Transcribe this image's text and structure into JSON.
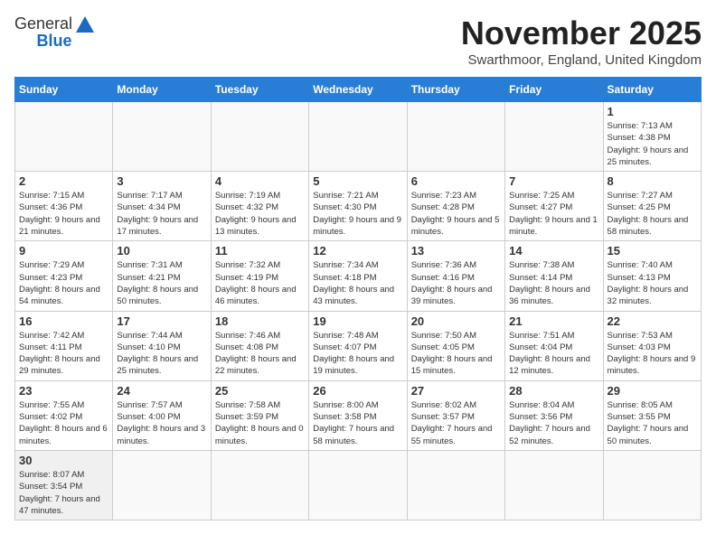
{
  "header": {
    "logo_general": "General",
    "logo_blue": "Blue",
    "month_title": "November 2025",
    "location": "Swarthmoor, England, United Kingdom"
  },
  "days_of_week": [
    "Sunday",
    "Monday",
    "Tuesday",
    "Wednesday",
    "Thursday",
    "Friday",
    "Saturday"
  ],
  "weeks": [
    [
      {
        "day": "",
        "info": ""
      },
      {
        "day": "",
        "info": ""
      },
      {
        "day": "",
        "info": ""
      },
      {
        "day": "",
        "info": ""
      },
      {
        "day": "",
        "info": ""
      },
      {
        "day": "",
        "info": ""
      },
      {
        "day": "1",
        "info": "Sunrise: 7:13 AM\nSunset: 4:38 PM\nDaylight: 9 hours and 25 minutes."
      }
    ],
    [
      {
        "day": "2",
        "info": "Sunrise: 7:15 AM\nSunset: 4:36 PM\nDaylight: 9 hours and 21 minutes."
      },
      {
        "day": "3",
        "info": "Sunrise: 7:17 AM\nSunset: 4:34 PM\nDaylight: 9 hours and 17 minutes."
      },
      {
        "day": "4",
        "info": "Sunrise: 7:19 AM\nSunset: 4:32 PM\nDaylight: 9 hours and 13 minutes."
      },
      {
        "day": "5",
        "info": "Sunrise: 7:21 AM\nSunset: 4:30 PM\nDaylight: 9 hours and 9 minutes."
      },
      {
        "day": "6",
        "info": "Sunrise: 7:23 AM\nSunset: 4:28 PM\nDaylight: 9 hours and 5 minutes."
      },
      {
        "day": "7",
        "info": "Sunrise: 7:25 AM\nSunset: 4:27 PM\nDaylight: 9 hours and 1 minute."
      },
      {
        "day": "8",
        "info": "Sunrise: 7:27 AM\nSunset: 4:25 PM\nDaylight: 8 hours and 58 minutes."
      }
    ],
    [
      {
        "day": "9",
        "info": "Sunrise: 7:29 AM\nSunset: 4:23 PM\nDaylight: 8 hours and 54 minutes."
      },
      {
        "day": "10",
        "info": "Sunrise: 7:31 AM\nSunset: 4:21 PM\nDaylight: 8 hours and 50 minutes."
      },
      {
        "day": "11",
        "info": "Sunrise: 7:32 AM\nSunset: 4:19 PM\nDaylight: 8 hours and 46 minutes."
      },
      {
        "day": "12",
        "info": "Sunrise: 7:34 AM\nSunset: 4:18 PM\nDaylight: 8 hours and 43 minutes."
      },
      {
        "day": "13",
        "info": "Sunrise: 7:36 AM\nSunset: 4:16 PM\nDaylight: 8 hours and 39 minutes."
      },
      {
        "day": "14",
        "info": "Sunrise: 7:38 AM\nSunset: 4:14 PM\nDaylight: 8 hours and 36 minutes."
      },
      {
        "day": "15",
        "info": "Sunrise: 7:40 AM\nSunset: 4:13 PM\nDaylight: 8 hours and 32 minutes."
      }
    ],
    [
      {
        "day": "16",
        "info": "Sunrise: 7:42 AM\nSunset: 4:11 PM\nDaylight: 8 hours and 29 minutes."
      },
      {
        "day": "17",
        "info": "Sunrise: 7:44 AM\nSunset: 4:10 PM\nDaylight: 8 hours and 25 minutes."
      },
      {
        "day": "18",
        "info": "Sunrise: 7:46 AM\nSunset: 4:08 PM\nDaylight: 8 hours and 22 minutes."
      },
      {
        "day": "19",
        "info": "Sunrise: 7:48 AM\nSunset: 4:07 PM\nDaylight: 8 hours and 19 minutes."
      },
      {
        "day": "20",
        "info": "Sunrise: 7:50 AM\nSunset: 4:05 PM\nDaylight: 8 hours and 15 minutes."
      },
      {
        "day": "21",
        "info": "Sunrise: 7:51 AM\nSunset: 4:04 PM\nDaylight: 8 hours and 12 minutes."
      },
      {
        "day": "22",
        "info": "Sunrise: 7:53 AM\nSunset: 4:03 PM\nDaylight: 8 hours and 9 minutes."
      }
    ],
    [
      {
        "day": "23",
        "info": "Sunrise: 7:55 AM\nSunset: 4:02 PM\nDaylight: 8 hours and 6 minutes."
      },
      {
        "day": "24",
        "info": "Sunrise: 7:57 AM\nSunset: 4:00 PM\nDaylight: 8 hours and 3 minutes."
      },
      {
        "day": "25",
        "info": "Sunrise: 7:58 AM\nSunset: 3:59 PM\nDaylight: 8 hours and 0 minutes."
      },
      {
        "day": "26",
        "info": "Sunrise: 8:00 AM\nSunset: 3:58 PM\nDaylight: 7 hours and 58 minutes."
      },
      {
        "day": "27",
        "info": "Sunrise: 8:02 AM\nSunset: 3:57 PM\nDaylight: 7 hours and 55 minutes."
      },
      {
        "day": "28",
        "info": "Sunrise: 8:04 AM\nSunset: 3:56 PM\nDaylight: 7 hours and 52 minutes."
      },
      {
        "day": "29",
        "info": "Sunrise: 8:05 AM\nSunset: 3:55 PM\nDaylight: 7 hours and 50 minutes."
      }
    ],
    [
      {
        "day": "30",
        "info": "Sunrise: 8:07 AM\nSunset: 3:54 PM\nDaylight: 7 hours and 47 minutes."
      },
      {
        "day": "",
        "info": ""
      },
      {
        "day": "",
        "info": ""
      },
      {
        "day": "",
        "info": ""
      },
      {
        "day": "",
        "info": ""
      },
      {
        "day": "",
        "info": ""
      },
      {
        "day": "",
        "info": ""
      }
    ]
  ]
}
